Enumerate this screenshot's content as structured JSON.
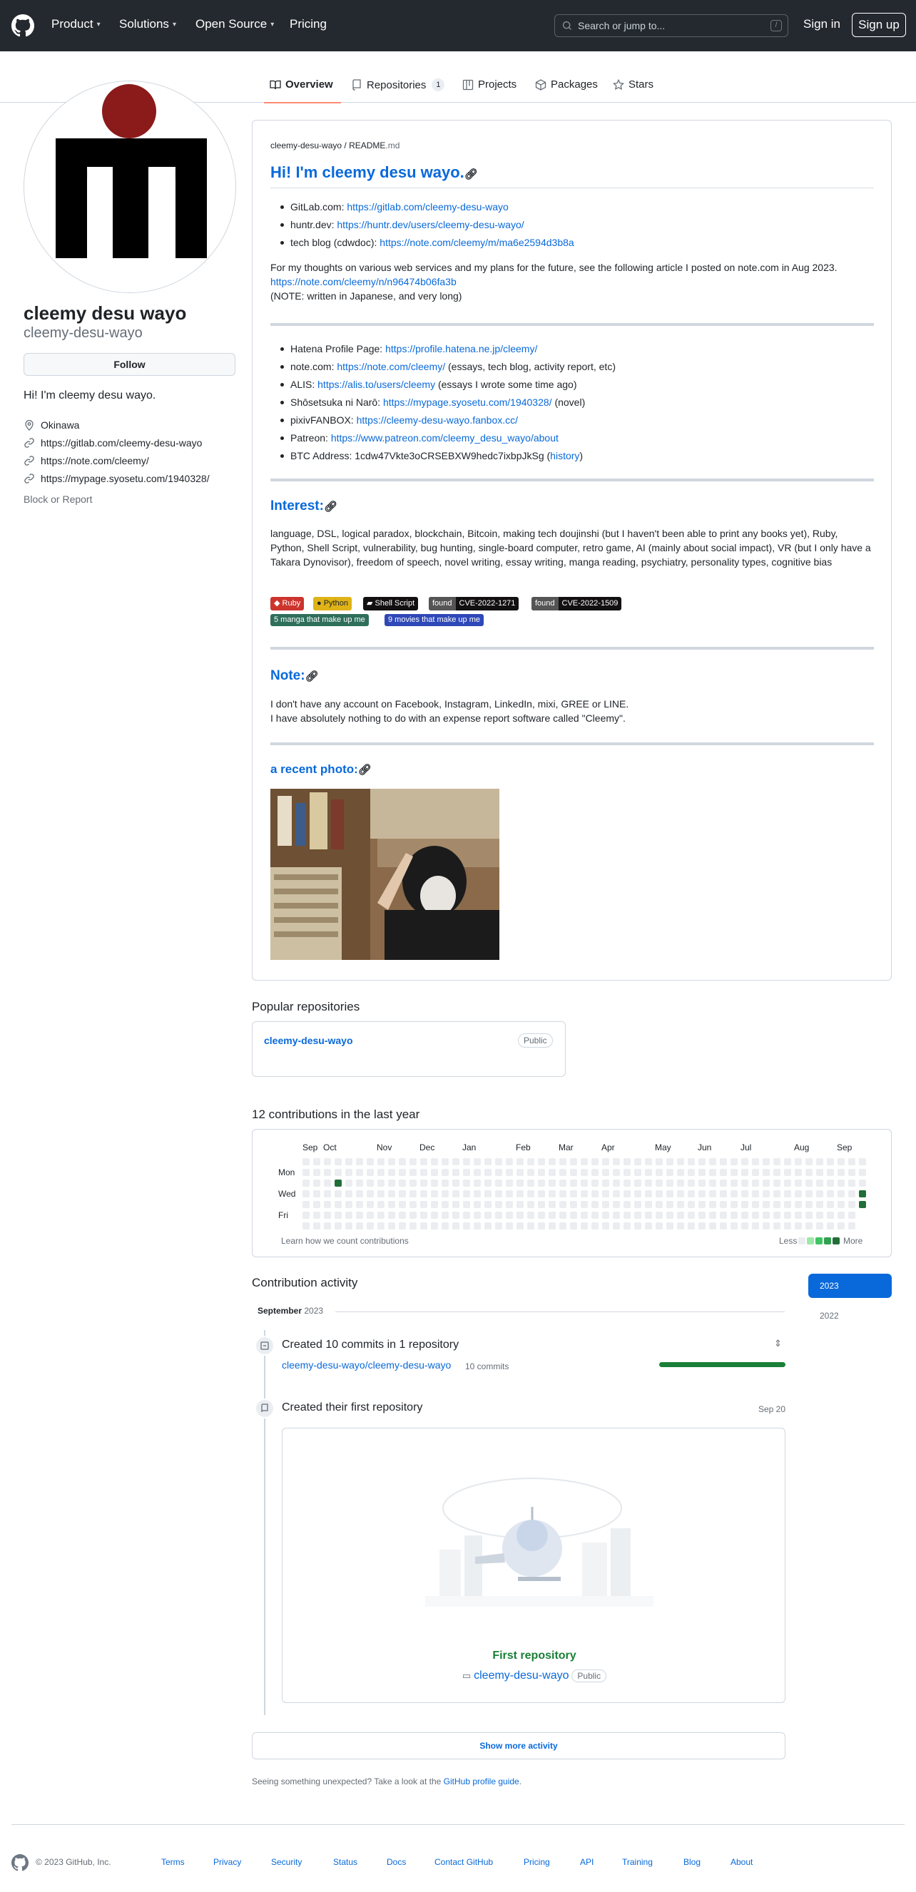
{
  "header": {
    "nav": [
      "Product",
      "Solutions",
      "Open Source",
      "Pricing"
    ],
    "search_placeholder": "Search or jump to...",
    "search_key": "/",
    "sign_in": "Sign in",
    "sign_up": "Sign up"
  },
  "tabs": [
    {
      "label": "Overview"
    },
    {
      "label": "Repositories",
      "count": "1"
    },
    {
      "label": "Projects"
    },
    {
      "label": "Packages"
    },
    {
      "label": "Stars"
    }
  ],
  "profile": {
    "name": "cleemy desu wayo",
    "login": "cleemy-desu-wayo",
    "follow": "Follow",
    "bio": "Hi! I'm cleemy desu wayo.",
    "location": "Okinawa",
    "links": [
      "https://gitlab.com/cleemy-desu-wayo",
      "https://note.com/cleemy/",
      "https://mypage.syosetu.com/1940328/"
    ],
    "block": "Block or Report"
  },
  "readme": {
    "path_user": "cleemy-desu-wayo",
    "path_sep": " / ",
    "path_file": "README",
    "path_ext": ".md",
    "title": "Hi! I'm cleemy desu wayo.",
    "list1": [
      {
        "label": "GitLab.com: ",
        "link": "https://gitlab.com/cleemy-desu-wayo",
        "rest": ""
      },
      {
        "label": "huntr.dev: ",
        "link": "https://huntr.dev/users/cleemy-desu-wayo/",
        "rest": ""
      },
      {
        "label": "tech blog (cdwdoc): ",
        "link": "https://note.com/cleemy/m/ma6e2594d3b8a",
        "rest": ""
      }
    ],
    "para1": "For my thoughts on various web services and my plans for the future, see the following article I posted on note.com in Aug 2023.",
    "para1_link": "https://note.com/cleemy/n/n96474b06fa3b",
    "para1_note": "(NOTE: written in Japanese, and very long)",
    "list2": [
      {
        "label": "Hatena Profile Page: ",
        "link": "https://profile.hatena.ne.jp/cleemy/",
        "rest": ""
      },
      {
        "label": "note.com: ",
        "link": "https://note.com/cleemy/",
        "rest": " (essays, tech blog, activity report, etc)"
      },
      {
        "label": "ALIS: ",
        "link": "https://alis.to/users/cleemy",
        "rest": " (essays I wrote some time ago)"
      },
      {
        "label": "Shōsetsuka ni Narō: ",
        "link": "https://mypage.syosetu.com/1940328/",
        "rest": " (novel)"
      },
      {
        "label": "pixivFANBOX: ",
        "link": "https://cleemy-desu-wayo.fanbox.cc/",
        "rest": ""
      },
      {
        "label": "Patreon: ",
        "link": "https://www.patreon.com/cleemy_desu_wayo/about",
        "rest": ""
      },
      {
        "label": "BTC Address: 1cdw47Vkte3oCRSEBXW9hedc7ixbpJkSg (",
        "link": "history",
        "rest": ")"
      }
    ],
    "interest_title": "Interest:",
    "interest_text": "language, DSL, logical paradox, blockchain, Bitcoin, making tech doujinshi (but I haven't been able to print any books yet), Ruby, Python, Shell Script, vulnerability, bug hunting, single-board computer, retro game, AI (mainly about social impact), VR (but I only have a Takara Dynovisor), freedom of speech, novel writing, essay writing, manga reading, psychiatry, personality types, cognitive bias",
    "badges": [
      {
        "text": "Ruby",
        "color": "#cc342d"
      },
      {
        "text": "Python",
        "color": "#dfb317"
      },
      {
        "text": "Shell Script",
        "color": "#121011"
      }
    ],
    "cve_badges": [
      {
        "left": "found",
        "right": "CVE-2022-1271"
      },
      {
        "left": "found",
        "right": "CVE-2022-1509"
      }
    ],
    "badges2": [
      {
        "text": "5 manga that make up me",
        "color": "#2f6e5a"
      },
      {
        "text": "9 movies that make up me",
        "color": "#2f48b8"
      }
    ],
    "note_title": "Note:",
    "note_line1": "I don't have any account on Facebook, Instagram, LinkedIn, mixi, GREE or LINE.",
    "note_line2": "I have absolutely nothing to do with an expense report software called \"Cleemy\".",
    "photo_title": "a recent photo:"
  },
  "popular": {
    "title": "Popular repositories",
    "repo": "cleemy-desu-wayo",
    "visibility": "Public"
  },
  "contrib": {
    "title": "12 contributions in the last year",
    "months": [
      "Sep",
      "Oct",
      "Nov",
      "Dec",
      "Jan",
      "Feb",
      "Mar",
      "Apr",
      "May",
      "Jun",
      "Jul",
      "Aug",
      "Sep"
    ],
    "days": [
      "Mon",
      "Wed",
      "Fri"
    ],
    "learn": "Learn how we count contributions",
    "less": "Less",
    "more": "More",
    "colors": [
      "#ebedf0",
      "#9be9a8",
      "#40c463",
      "#30a14e",
      "#216e39"
    ]
  },
  "activity": {
    "title": "Contribution activity",
    "years": [
      "2023",
      "2022"
    ],
    "month_label": "September",
    "month_year": "2023",
    "item1_title": "Created 10 commits in 1 repository",
    "item1_repo": "cleemy-desu-wayo/cleemy-desu-wayo",
    "item1_count": "10 commits",
    "item2_title": "Created their first repository",
    "item2_date": "Sep 20",
    "first_repo_label": "First repository",
    "first_repo_name": "cleemy-desu-wayo",
    "first_repo_vis": "Public",
    "show_more": "Show more activity",
    "unexpected": "Seeing something unexpected? Take a look at the ",
    "guide": "GitHub profile guide",
    "guide_end": "."
  },
  "footer": {
    "copyright": "© 2023 GitHub, Inc.",
    "links": [
      "Terms",
      "Privacy",
      "Security",
      "Status",
      "Docs",
      "Contact GitHub",
      "Pricing",
      "API",
      "Training",
      "Blog",
      "About"
    ]
  }
}
